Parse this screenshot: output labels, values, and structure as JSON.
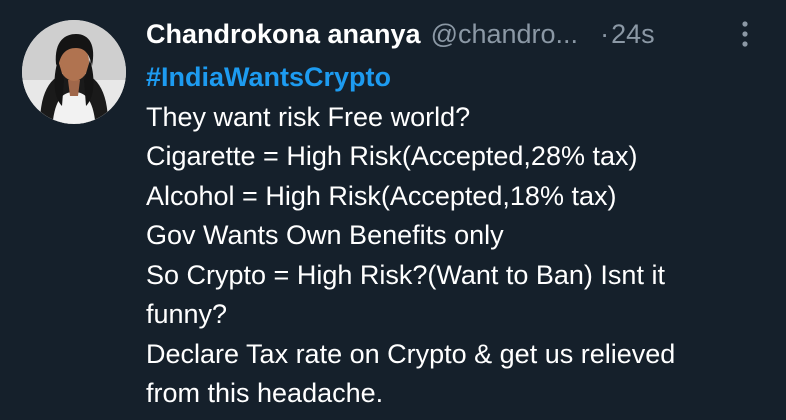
{
  "tweet": {
    "author": {
      "display_name": "Chandrokona ananya",
      "handle": "@chandro...",
      "avatar_icon": "avatar-photo"
    },
    "separator": "·",
    "timestamp": "24s",
    "more_icon": "vertical-dots-icon",
    "hashtag": "#IndiaWantsCrypto",
    "lines": [
      "They want risk Free world?",
      "Cigarette = High Risk(Accepted,28% tax)",
      "Alcohol = High Risk(Accepted,18% tax)",
      "Gov Wants Own Benefits only",
      "So Crypto = High Risk?(Want to Ban) Isnt it",
      "funny?",
      "Declare Tax rate on Crypto & get us relieved",
      "from this headache."
    ]
  },
  "colors": {
    "background": "#15202b",
    "text": "#ffffff",
    "secondary": "#8b98a5",
    "accent": "#1d9bf0"
  }
}
